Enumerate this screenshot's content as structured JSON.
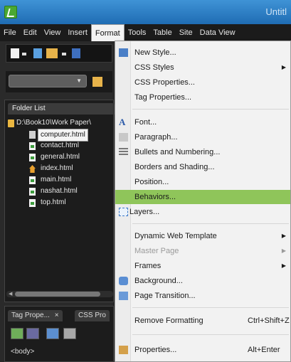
{
  "title_bar": {
    "title": "Untitl"
  },
  "menubar": [
    "File",
    "Edit",
    "View",
    "Insert",
    "Format",
    "Tools",
    "Table",
    "Site",
    "Data View"
  ],
  "folder_panel": {
    "tab": "Folder List",
    "root": "D:\\Book10\\Work Paper\\",
    "files": [
      "computer.html",
      "contact.html",
      "general.html",
      "index.html",
      "main.html",
      "nashat.html",
      "top.html"
    ]
  },
  "tag_panel": {
    "tabs": [
      "Tag Prope...",
      "×",
      "CSS Pro"
    ],
    "body_tag": "<body>"
  },
  "format_menu": {
    "items": [
      {
        "label": "New Style..."
      },
      {
        "label": "CSS Styles",
        "submenu": true
      },
      {
        "label": "CSS Properties..."
      },
      {
        "label": "Tag Properties..."
      },
      {
        "label": "Font..."
      },
      {
        "label": "Paragraph..."
      },
      {
        "label": "Bullets and Numbering..."
      },
      {
        "label": "Borders and Shading..."
      },
      {
        "label": "Position..."
      },
      {
        "label": "Behaviors..."
      },
      {
        "label": "Layers..."
      },
      {
        "label": "Dynamic Web Template",
        "submenu": true
      },
      {
        "label": "Master Page"
      },
      {
        "label": "Frames",
        "submenu": true
      },
      {
        "label": "Background..."
      },
      {
        "label": "Page Transition..."
      },
      {
        "label": "Remove Formatting",
        "shortcut": "Ctrl+Shift+Z"
      },
      {
        "label": "Properties...",
        "shortcut": "Alt+Enter"
      }
    ]
  },
  "colors": {
    "highlight": "#8fc55a",
    "titlebar": "#2f82c7"
  }
}
